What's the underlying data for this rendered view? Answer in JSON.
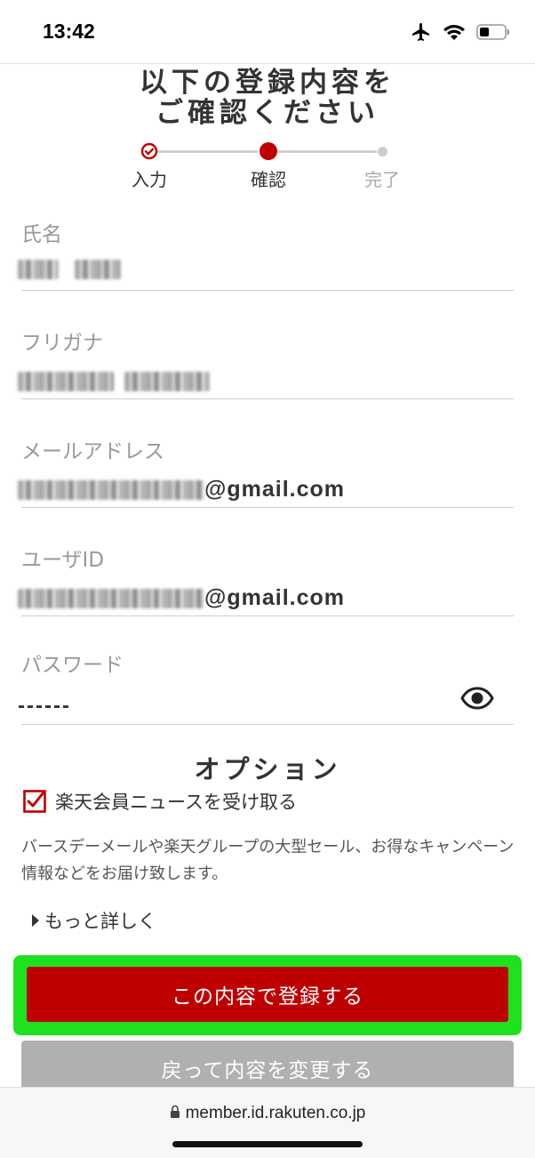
{
  "status_bar": {
    "time": "13:42",
    "icons": [
      "airplane-icon",
      "wifi-icon",
      "battery-icon"
    ]
  },
  "header": {
    "title_line1": "以下の登録内容を",
    "title_line2": "ご確認ください"
  },
  "stepper": {
    "steps": [
      {
        "label": "入力",
        "state": "done"
      },
      {
        "label": "確認",
        "state": "current"
      },
      {
        "label": "完了",
        "state": "pending"
      }
    ],
    "accent_color": "#bf0000"
  },
  "form": {
    "name": {
      "label": "氏名",
      "value_masked": true
    },
    "furigana": {
      "label": "フリガナ",
      "value_masked": true
    },
    "email": {
      "label": "メールアドレス",
      "value_suffix": "@gmail.com"
    },
    "user_id": {
      "label": "ユーザID",
      "value_suffix": "@gmail.com"
    },
    "password": {
      "label": "パスワード",
      "value": "------",
      "toggle_icon": "eye-icon"
    }
  },
  "options": {
    "title": "オプション",
    "newsletter_label": "楽天会員ニュースを受け取る",
    "newsletter_checked": true,
    "description": "バースデーメールや楽天グループの大型セール、お得なキャンペーン情報などをお届け致します。",
    "more_link": "もっと詳しく"
  },
  "buttons": {
    "submit": "この内容で登録する",
    "back": "戻って内容を変更する"
  },
  "browser": {
    "url": "member.id.rakuten.co.jp",
    "lock_icon": "lock-icon"
  },
  "colors": {
    "primary": "#bf0000",
    "highlight": "#1ee21e",
    "secondary_button": "#b0b0b0"
  }
}
